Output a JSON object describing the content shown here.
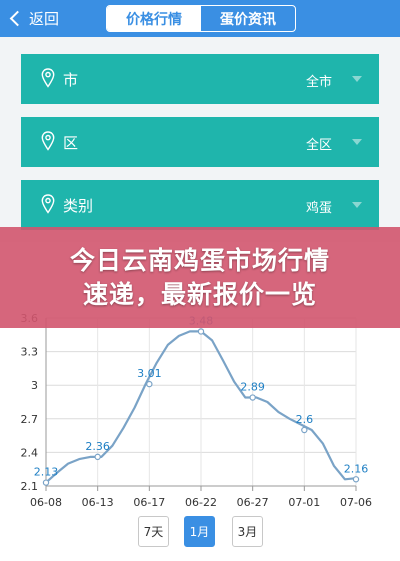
{
  "header": {
    "back_label": "返回",
    "tabs": [
      {
        "label": "价格行情",
        "active": true
      },
      {
        "label": "蛋价资讯",
        "active": false
      }
    ],
    "color": "#3a8fe3"
  },
  "filters": [
    {
      "label": "市",
      "value": "全市",
      "icon": "location-pin-icon"
    },
    {
      "label": "区",
      "value": "全区",
      "icon": "location-pin-icon"
    },
    {
      "label": "类别",
      "value": "鸡蛋",
      "icon": "location-pin-icon"
    }
  ],
  "filter_color": "#1fb5ac",
  "banner": {
    "line1": "今日云南鸡蛋市场行情",
    "line2": "速递，最新报价一览",
    "color": "#d2556e"
  },
  "range_buttons": [
    {
      "label": "7天",
      "active": false
    },
    {
      "label": "1月",
      "active": true
    },
    {
      "label": "3月",
      "active": false
    }
  ],
  "chart_data": {
    "type": "line",
    "x_ticks": [
      "06-08",
      "06-13",
      "06-17",
      "06-22",
      "06-27",
      "07-01",
      "07-06"
    ],
    "y_ticks": [
      "2.1",
      "2.4",
      "2.7",
      "3",
      "3.3",
      "3.6"
    ],
    "ylim": [
      2.1,
      3.6
    ],
    "grid": true,
    "line_color": "#7aa3c7",
    "labeled_points": [
      {
        "x": "06-08",
        "y": 2.13,
        "label": "2.13"
      },
      {
        "x": "06-13",
        "y": 2.36,
        "label": "2.36"
      },
      {
        "x": "06-17",
        "y": 3.01,
        "label": "3.01"
      },
      {
        "x": "06-22",
        "y": 3.48,
        "label": "3.48"
      },
      {
        "x": "06-27",
        "y": 2.89,
        "label": "2.89"
      },
      {
        "x": "07-01",
        "y": 2.6,
        "label": "2.6"
      },
      {
        "x": "07-06",
        "y": 2.16,
        "label": "2.16"
      }
    ],
    "series": [
      {
        "x": [
          0,
          1,
          2,
          3,
          4,
          5,
          6,
          7,
          8,
          9,
          10,
          11,
          12,
          13,
          14,
          15,
          16,
          17,
          18,
          19,
          20,
          21,
          22,
          23,
          24,
          25,
          26,
          27,
          28
        ],
        "values": [
          2.13,
          2.22,
          2.3,
          2.34,
          2.36,
          2.36,
          2.46,
          2.62,
          2.8,
          3.01,
          3.2,
          3.36,
          3.44,
          3.48,
          3.48,
          3.4,
          3.22,
          3.03,
          2.89,
          2.89,
          2.85,
          2.76,
          2.7,
          2.65,
          2.6,
          2.48,
          2.28,
          2.16,
          2.17
        ]
      }
    ]
  }
}
